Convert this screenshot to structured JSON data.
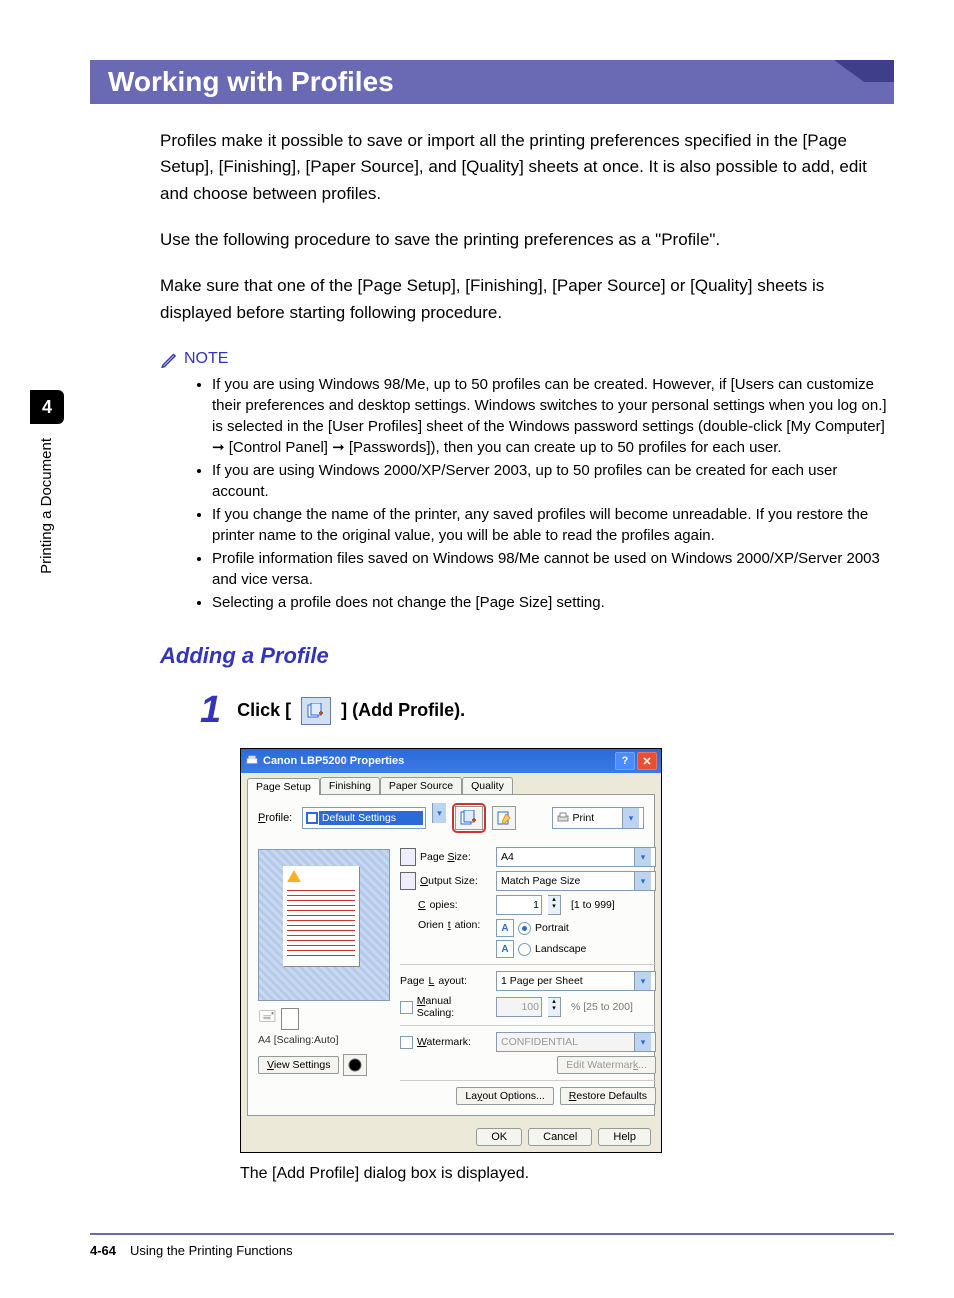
{
  "side": {
    "chapter": "4",
    "running": "Printing a Document"
  },
  "title": "Working with Profiles",
  "paragraphs": {
    "p1": "Profiles make it possible to save or import all the printing preferences specified in the [Page Setup], [Finishing], [Paper Source], and [Quality] sheets at once. It is also possible to add, edit and choose between profiles.",
    "p2": "Use the following procedure to save the printing preferences as a \"Profile\".",
    "p3": "Make sure that one of the [Page Setup], [Finishing], [Paper Source] or [Quality] sheets is displayed before starting following procedure."
  },
  "note": {
    "label": "NOTE",
    "items": [
      "If you are using Windows 98/Me, up to 50 profiles can be created. However, if [Users can customize their preferences and desktop settings. Windows switches to your personal settings when you log on.] is selected in the [User Profiles] sheet of the Windows password settings (double-click [My Computer] ➞ [Control Panel] ➞ [Passwords]), then you can create up to 50 profiles for each user.",
      "If you are using Windows 2000/XP/Server 2003, up to 50 profiles can be created for each user account.",
      "If you change the name of the printer, any saved profiles will become unreadable. If you restore the printer name to the original value, you will be able to read the profiles again.",
      "Profile information files saved on Windows 98/Me cannot be used on Windows 2000/XP/Server 2003 and vice versa.",
      "Selecting a profile does not change the [Page Size] setting."
    ]
  },
  "subhead": "Adding a Profile",
  "step1": {
    "num": "1",
    "pre": "Click [",
    "post": "] (Add Profile)."
  },
  "dialog": {
    "title": "Canon LBP5200 Properties",
    "tabs": {
      "t1": "Page Setup",
      "t2": "Finishing",
      "t3": "Paper Source",
      "t4": "Quality"
    },
    "profile_label": "Profile:",
    "profile_value": "Default Settings",
    "print_label": "Print",
    "page_size_label": "Page Size:",
    "page_size_value": "A4",
    "output_size_label": "Output Size:",
    "output_size_value": "Match Page Size",
    "copies_label": "Copies:",
    "copies_value": "1",
    "copies_range": "[1 to 999]",
    "orientation_label": "Orientation:",
    "portrait": "Portrait",
    "landscape": "Landscape",
    "page_layout_label": "Page Layout:",
    "page_layout_value": "1 Page per Sheet",
    "manual_scaling_label": "Manual Scaling:",
    "scale_value": "100",
    "scale_suffix": "%  [25 to 200]",
    "watermark_label": "Watermark:",
    "watermark_value": "CONFIDENTIAL",
    "edit_watermark": "Edit Watermark...",
    "preview_caption": "A4 [Scaling:Auto]",
    "view_settings": "View Settings",
    "layout_options": "Layout Options...",
    "restore_defaults": "Restore Defaults",
    "ok": "OK",
    "cancel": "Cancel",
    "help": "Help"
  },
  "after_shot": "The [Add Profile] dialog box is displayed.",
  "footer": {
    "page": "4-64",
    "section": "Using the Printing Functions"
  }
}
